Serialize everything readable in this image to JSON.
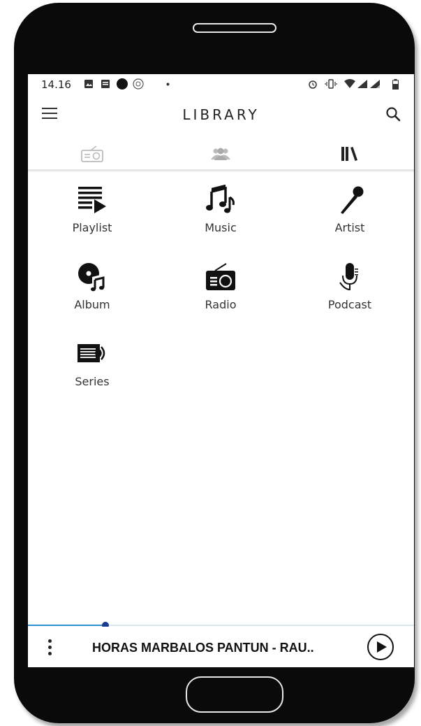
{
  "status_bar": {
    "time": "14.16"
  },
  "header": {
    "title": "LIBRARY",
    "menu_icon": "hamburger-menu-icon",
    "search_icon": "search-icon"
  },
  "tabs": [
    {
      "icon": "radio-tab-icon",
      "active": false
    },
    {
      "icon": "people-tab-icon",
      "active": false
    },
    {
      "icon": "library-tab-icon",
      "active": true
    }
  ],
  "categories": [
    {
      "label": "Playlist",
      "icon": "playlist-icon"
    },
    {
      "label": "Music",
      "icon": "music-note-icon"
    },
    {
      "label": "Artist",
      "icon": "microphone-icon"
    },
    {
      "label": "Album",
      "icon": "album-icon"
    },
    {
      "label": "Radio",
      "icon": "radio-icon"
    },
    {
      "label": "Podcast",
      "icon": "podcast-mic-icon"
    },
    {
      "label": "Series",
      "icon": "series-icon"
    }
  ],
  "player": {
    "track_title": "HORAS MARBALOS PANTUN - RAU..",
    "progress": 0.2,
    "accent_color": "#2f8fd3"
  }
}
